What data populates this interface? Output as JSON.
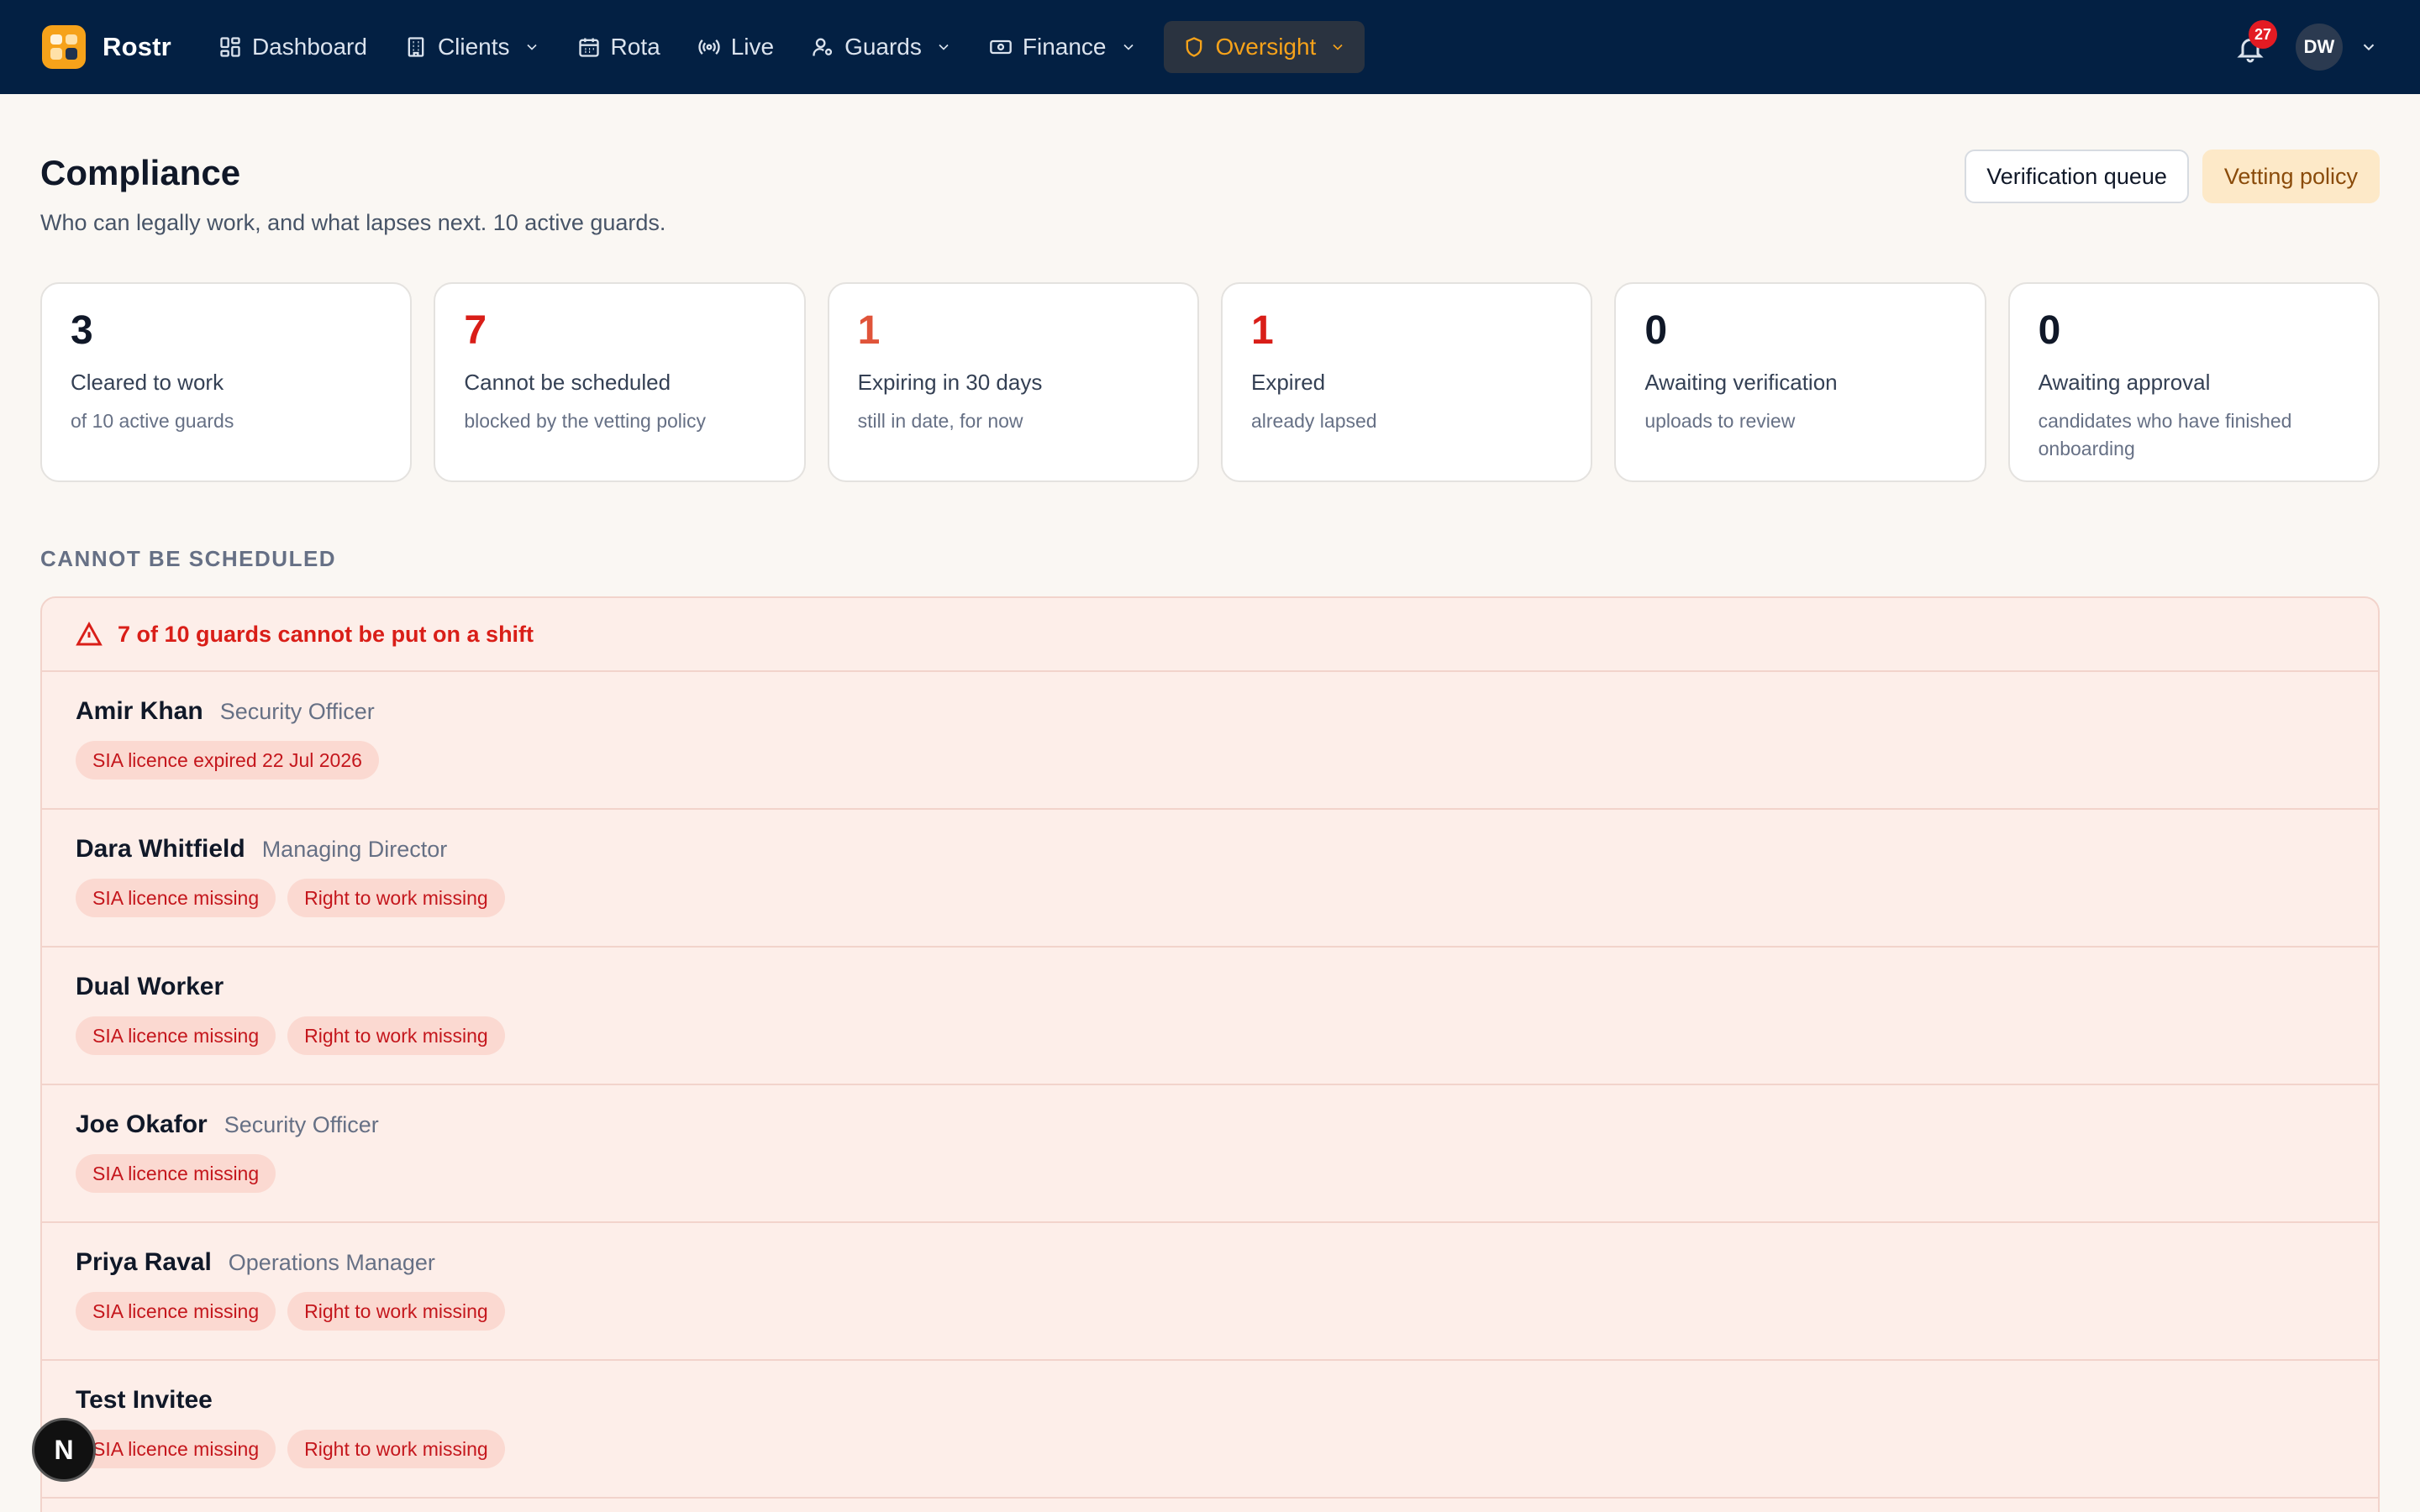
{
  "nav": {
    "brand": "Rostr",
    "items": [
      {
        "label": "Dashboard",
        "icon": "grid-icon",
        "dropdown": false
      },
      {
        "label": "Clients",
        "icon": "building-icon",
        "dropdown": true
      },
      {
        "label": "Rota",
        "icon": "calendar-icon",
        "dropdown": false
      },
      {
        "label": "Live",
        "icon": "broadcast-icon",
        "dropdown": false
      },
      {
        "label": "Guards",
        "icon": "user-cog-icon",
        "dropdown": true
      },
      {
        "label": "Finance",
        "icon": "banknote-icon",
        "dropdown": true
      },
      {
        "label": "Oversight",
        "icon": "shield-icon",
        "dropdown": true,
        "active": true
      }
    ],
    "notification_count": "27",
    "user_initials": "DW"
  },
  "header": {
    "title": "Compliance",
    "subtitle": "Who can legally work, and what lapses next. 10 active guards.",
    "buttons": {
      "verification_queue": "Verification queue",
      "vetting_policy": "Vetting policy"
    }
  },
  "stats": [
    {
      "value": "3",
      "label": "Cleared to work",
      "sub": "of 10 active guards"
    },
    {
      "value": "7",
      "label": "Cannot be scheduled",
      "sub": "blocked by the vetting policy"
    },
    {
      "value": "1",
      "label": "Expiring in 30 days",
      "sub": "still in date, for now"
    },
    {
      "value": "1",
      "label": "Expired",
      "sub": "already lapsed"
    },
    {
      "value": "0",
      "label": "Awaiting verification",
      "sub": "uploads to review"
    },
    {
      "value": "0",
      "label": "Awaiting approval",
      "sub": "candidates who have finished onboarding"
    }
  ],
  "section": {
    "label": "CANNOT BE SCHEDULED",
    "alert": "7 of 10 guards cannot be put on a shift",
    "rows": [
      {
        "name": "Amir Khan",
        "role": "Security Officer",
        "tags": [
          "SIA licence expired 22 Jul 2026"
        ]
      },
      {
        "name": "Dara Whitfield",
        "role": "Managing Director",
        "tags": [
          "SIA licence missing",
          "Right to work missing"
        ]
      },
      {
        "name": "Dual Worker",
        "role": "",
        "tags": [
          "SIA licence missing",
          "Right to work missing"
        ]
      },
      {
        "name": "Joe Okafor",
        "role": "Security Officer",
        "tags": [
          "SIA licence missing"
        ]
      },
      {
        "name": "Priya Raval",
        "role": "Operations Manager",
        "tags": [
          "SIA licence missing",
          "Right to work missing"
        ]
      },
      {
        "name": "Test Invitee",
        "role": "",
        "tags": [
          "SIA licence missing",
          "Right to work missing"
        ]
      }
    ]
  },
  "fab_label": "N",
  "colors": {
    "nav_bg": "#032043",
    "accent": "#f6a21a",
    "danger": "#d91e18",
    "panel_bg": "#fdeee9"
  }
}
